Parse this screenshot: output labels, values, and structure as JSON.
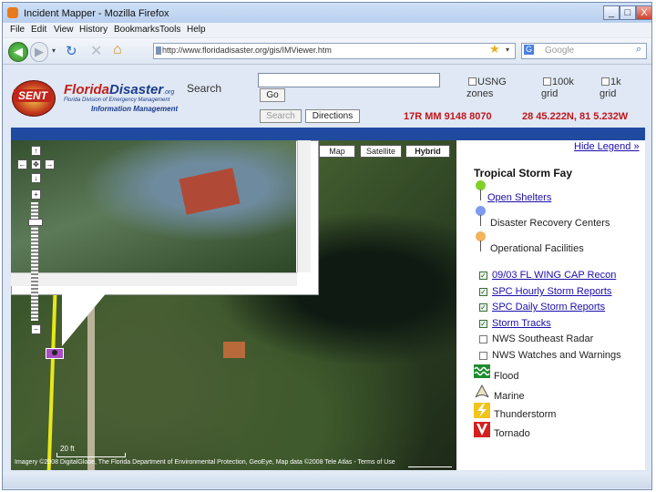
{
  "window": {
    "title": "Incident Mapper - Mozilla Firefox",
    "min": "_",
    "max": "□",
    "close": "X"
  },
  "menu": [
    "File",
    "Edit",
    "View",
    "History",
    "Bookmarks",
    "Tools",
    "Help"
  ],
  "nav": {
    "url": "http://www.floridadisaster.org/gis/IMViewer.htm",
    "search_placeholder": "Google"
  },
  "header": {
    "seal_text": "SENT",
    "logo_title_a": "Florida",
    "logo_title_b": "Disaster",
    "logo_title_c": ".org",
    "logo_sub": "Florida Division of Emergency Management",
    "logo_sub2": "Information Management",
    "search_label": "Search",
    "go_label": "Go",
    "option1": "USNG zones",
    "option2": "100k grid",
    "option3": "1k grid",
    "search_tab": "Search",
    "directions_tab": "Directions",
    "usng_coord": "17R MM 9148 8070",
    "latlon_coord": "28 45.222N, 81 5.232W"
  },
  "map": {
    "types": [
      "Map",
      "Satellite",
      "Hybrid"
    ],
    "scale": "20 ft",
    "credit": "Imagery ©2008 DigitalGlobe, The Florida Department of Environmental Protection, GeoEye, Map data ©2008 Tele Atlas - Terms of Use",
    "pan_up": "↑",
    "pan_left": "←",
    "pan_center": "✥",
    "pan_right": "→",
    "pan_down": "↓",
    "zoom_in": "+",
    "zoom_out": "−"
  },
  "legend": {
    "hide_label": "Hide Legend »",
    "title": "Tropical Storm Fay",
    "pins": [
      {
        "label": "Open Shelters",
        "color": "#7fd12a",
        "link": true
      },
      {
        "label": "Disaster Recovery Centers",
        "color": "#7f9bef",
        "link": false
      },
      {
        "label": "Operational Facilities",
        "color": "#f3b25c",
        "link": false
      }
    ],
    "layers": [
      {
        "label": "09/03 FL WING CAP Recon",
        "checked": true,
        "link": true
      },
      {
        "label": "SPC Hourly Storm Reports",
        "checked": true,
        "link": true
      },
      {
        "label": "SPC Daily Storm Reports",
        "checked": true,
        "link": true
      },
      {
        "label": "Storm Tracks",
        "checked": true,
        "link": true
      },
      {
        "label": "NWS Southeast Radar",
        "checked": false,
        "link": false
      },
      {
        "label": "NWS Watches and Warnings",
        "checked": false,
        "link": false
      }
    ],
    "symbols": [
      {
        "label": "Flood",
        "icon": "flood-icon",
        "color": "#1f8b2f"
      },
      {
        "label": "Marine",
        "icon": "marine-icon",
        "color": "#e9e2c2"
      },
      {
        "label": "Thunderstorm",
        "icon": "thunderstorm-icon",
        "color": "#f2c31a"
      },
      {
        "label": "Tornado",
        "icon": "tornado-icon",
        "color": "#d51e1e"
      }
    ]
  }
}
